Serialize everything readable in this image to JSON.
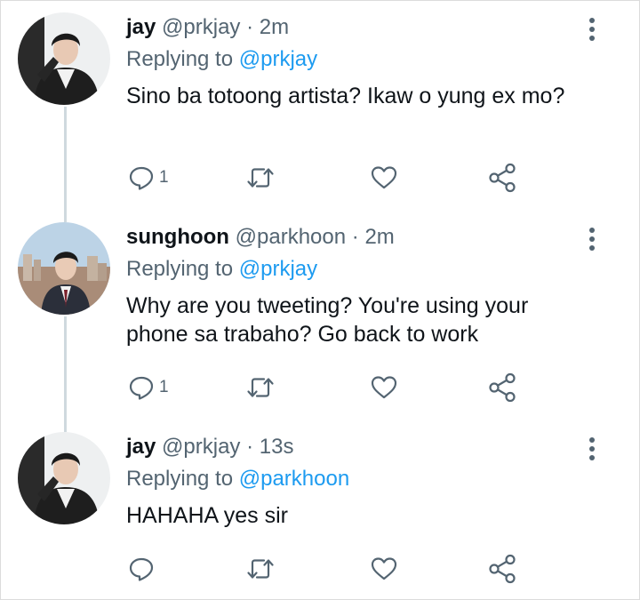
{
  "tweets": [
    {
      "name": "jay",
      "handle": "@prkjay",
      "dot": "·",
      "time": "2m",
      "replying_prefix": "Replying to",
      "replying_to": "@prkjay",
      "text": "Sino ba totoong artista? Ikaw o yung ex mo?",
      "reply_count": "1"
    },
    {
      "name": "sunghoon",
      "handle": "@parkhoon",
      "dot": "·",
      "time": "2m",
      "replying_prefix": "Replying to",
      "replying_to": "@prkjay",
      "text": "Why are you tweeting? You're using your phone sa trabaho? Go back to work",
      "reply_count": "1"
    },
    {
      "name": "jay",
      "handle": "@prkjay",
      "dot": "·",
      "time": "13s",
      "replying_prefix": "Replying to",
      "replying_to": "@parkhoon",
      "text": "HAHAHA yes sir",
      "reply_count": ""
    }
  ],
  "icons": {
    "reply": "reply-icon",
    "retweet": "retweet-icon",
    "like": "heart-icon",
    "share": "share-icon",
    "more": "more-vertical-icon"
  },
  "colors": {
    "link": "#1d9bf0",
    "secondary_text": "#536471",
    "icon": "#536471",
    "thread_line": "#cfd9de"
  }
}
